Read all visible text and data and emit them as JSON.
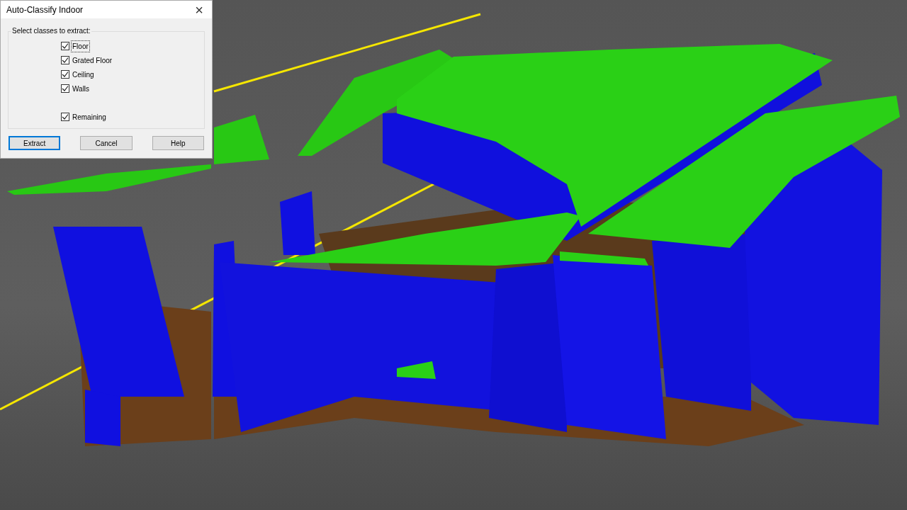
{
  "dialog": {
    "title": "Auto-Classify Indoor",
    "close": "×",
    "group_label": "Select classes to extract:",
    "classes": [
      {
        "label": "Floor",
        "checked": true,
        "focused": true
      },
      {
        "label": "Grated Floor",
        "checked": true,
        "focused": false
      },
      {
        "label": "Ceiling",
        "checked": true,
        "focused": false
      },
      {
        "label": "Walls",
        "checked": true,
        "focused": false
      }
    ],
    "remaining": {
      "label": "Remaining",
      "checked": true,
      "focused": false
    },
    "buttons": [
      {
        "label": "Extract",
        "default": true
      },
      {
        "label": "Cancel",
        "default": false
      },
      {
        "label": "Help",
        "default": false
      }
    ]
  }
}
